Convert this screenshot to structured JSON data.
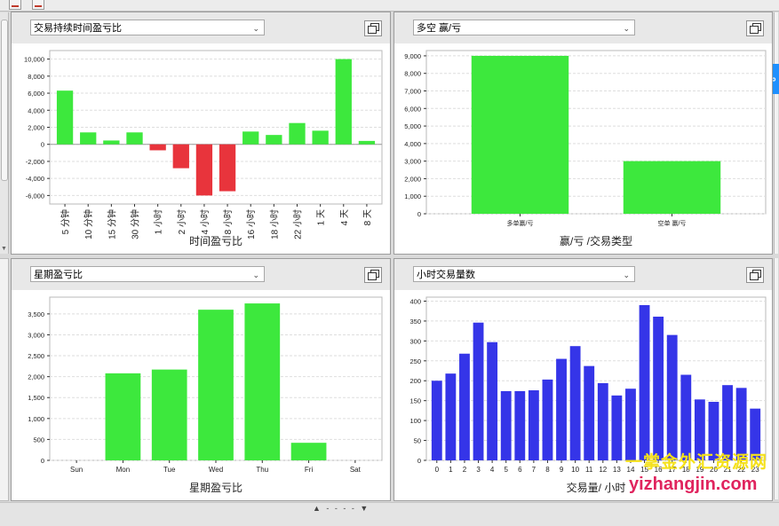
{
  "colors": {
    "positive": "#3de83d",
    "negative": "#e8343c",
    "blue": "#3535e8",
    "grid": "#dedede",
    "axis": "#333333"
  },
  "watermark": {
    "line1": "一掌金外汇资源网",
    "line2": "yizhangjin.com"
  },
  "panels": [
    {
      "dropdown_value": "交易持续时间盈亏比",
      "chart": {
        "type": "bar",
        "xlabel": "时间盈亏比",
        "ylim": [
          -7000,
          11000
        ],
        "ticks": [
          -6000,
          -4000,
          -2000,
          0,
          2000,
          4000,
          6000,
          8000,
          10000
        ],
        "tick_labels": [
          "-6,000",
          "-4,000",
          "-2,000",
          "0",
          "2,000",
          "4,000",
          "6,000",
          "8,000",
          "10,000"
        ],
        "categories": [
          "5 分钟",
          "10 分钟",
          "15 分钟",
          "30 分钟",
          "1 小时",
          "2 小时",
          "4 小时",
          "8 小时",
          "16 小时",
          "18 小时",
          "22 小时",
          "1 天",
          "4 天",
          "8 天"
        ],
        "values": [
          6300,
          1400,
          450,
          1400,
          -700,
          -2800,
          -6000,
          -5500,
          1500,
          1100,
          2500,
          1600,
          10000,
          400
        ],
        "rotated": true
      }
    },
    {
      "dropdown_value": "多空 赢/亏",
      "chart": {
        "type": "bar",
        "xlabel": "赢/亏 /交易类型",
        "ylim": [
          0,
          9300
        ],
        "ticks": [
          0,
          1000,
          2000,
          3000,
          4000,
          5000,
          6000,
          7000,
          8000,
          9000
        ],
        "tick_labels": [
          "0",
          "1,000",
          "2,000",
          "3,000",
          "4,000",
          "5,000",
          "6,000",
          "7,000",
          "8,000",
          "9,000"
        ],
        "categories": [
          "多单赢/亏",
          "空单 赢/亏"
        ],
        "values": [
          9000,
          3000
        ],
        "rotated": false
      }
    },
    {
      "dropdown_value": "星期盈亏比",
      "chart": {
        "type": "bar",
        "xlabel": "星期盈亏比",
        "ylim": [
          0,
          3900
        ],
        "ticks": [
          0,
          500,
          1000,
          1500,
          2000,
          2500,
          3000,
          3500
        ],
        "tick_labels": [
          "0",
          "500",
          "1,000",
          "1,500",
          "2,000",
          "2,500",
          "3,000",
          "3,500"
        ],
        "categories": [
          "Sun",
          "Mon",
          "Tue",
          "Wed",
          "Thu",
          "Fri",
          "Sat"
        ],
        "values": [
          0,
          2080,
          2170,
          3600,
          3750,
          420,
          0
        ],
        "rotated": false
      }
    },
    {
      "dropdown_value": "小时交易量数",
      "chart": {
        "type": "bar",
        "xlabel": "交易量/ 小时",
        "ylim": [
          0,
          410
        ],
        "ticks": [
          0,
          50,
          100,
          150,
          200,
          250,
          300,
          350,
          400
        ],
        "tick_labels": [
          "0",
          "50",
          "100",
          "150",
          "200",
          "250",
          "300",
          "350",
          "400"
        ],
        "categories": [
          "0",
          "1",
          "2",
          "3",
          "4",
          "5",
          "6",
          "7",
          "8",
          "9",
          "10",
          "11",
          "12",
          "13",
          "14",
          "15",
          "16",
          "17",
          "18",
          "19",
          "20",
          "21",
          "22",
          "23"
        ],
        "values": [
          200,
          218,
          268,
          346,
          297,
          174,
          174,
          176,
          203,
          255,
          287,
          237,
          194,
          163,
          180,
          390,
          361,
          315,
          215,
          153,
          147,
          189,
          182,
          130
        ],
        "rotated": false
      }
    }
  ],
  "chart_data": [
    {
      "type": "bar",
      "categories": [
        "5 分钟",
        "10 分钟",
        "15 分钟",
        "30 分钟",
        "1 小时",
        "2 小时",
        "4 小时",
        "8 小时",
        "16 小时",
        "18 小时",
        "22 小时",
        "1 天",
        "4 天",
        "8 天"
      ],
      "values": [
        6300,
        1400,
        450,
        1400,
        -700,
        -2800,
        -6000,
        -5500,
        1500,
        1100,
        2500,
        1600,
        10000,
        400
      ],
      "xlabel": "时间盈亏比",
      "ylabel": "",
      "ylim": [
        -7000,
        11000
      ],
      "grid": true
    },
    {
      "type": "bar",
      "categories": [
        "多单赢/亏",
        "空单 赢/亏"
      ],
      "values": [
        9000,
        3000
      ],
      "xlabel": "赢/亏 /交易类型",
      "ylabel": "",
      "ylim": [
        0,
        9300
      ],
      "grid": true
    },
    {
      "type": "bar",
      "categories": [
        "Sun",
        "Mon",
        "Tue",
        "Wed",
        "Thu",
        "Fri",
        "Sat"
      ],
      "values": [
        0,
        2080,
        2170,
        3600,
        3750,
        420,
        0
      ],
      "xlabel": "星期盈亏比",
      "ylabel": "",
      "ylim": [
        0,
        3900
      ],
      "grid": true
    },
    {
      "type": "bar",
      "categories": [
        "0",
        "1",
        "2",
        "3",
        "4",
        "5",
        "6",
        "7",
        "8",
        "9",
        "10",
        "11",
        "12",
        "13",
        "14",
        "15",
        "16",
        "17",
        "18",
        "19",
        "20",
        "21",
        "22",
        "23"
      ],
      "values": [
        200,
        218,
        268,
        346,
        297,
        174,
        174,
        176,
        203,
        255,
        287,
        237,
        194,
        163,
        180,
        390,
        361,
        315,
        215,
        153,
        147,
        189,
        182,
        130
      ],
      "xlabel": "交易量/ 小时",
      "ylabel": "",
      "ylim": [
        0,
        410
      ],
      "grid": true
    }
  ]
}
